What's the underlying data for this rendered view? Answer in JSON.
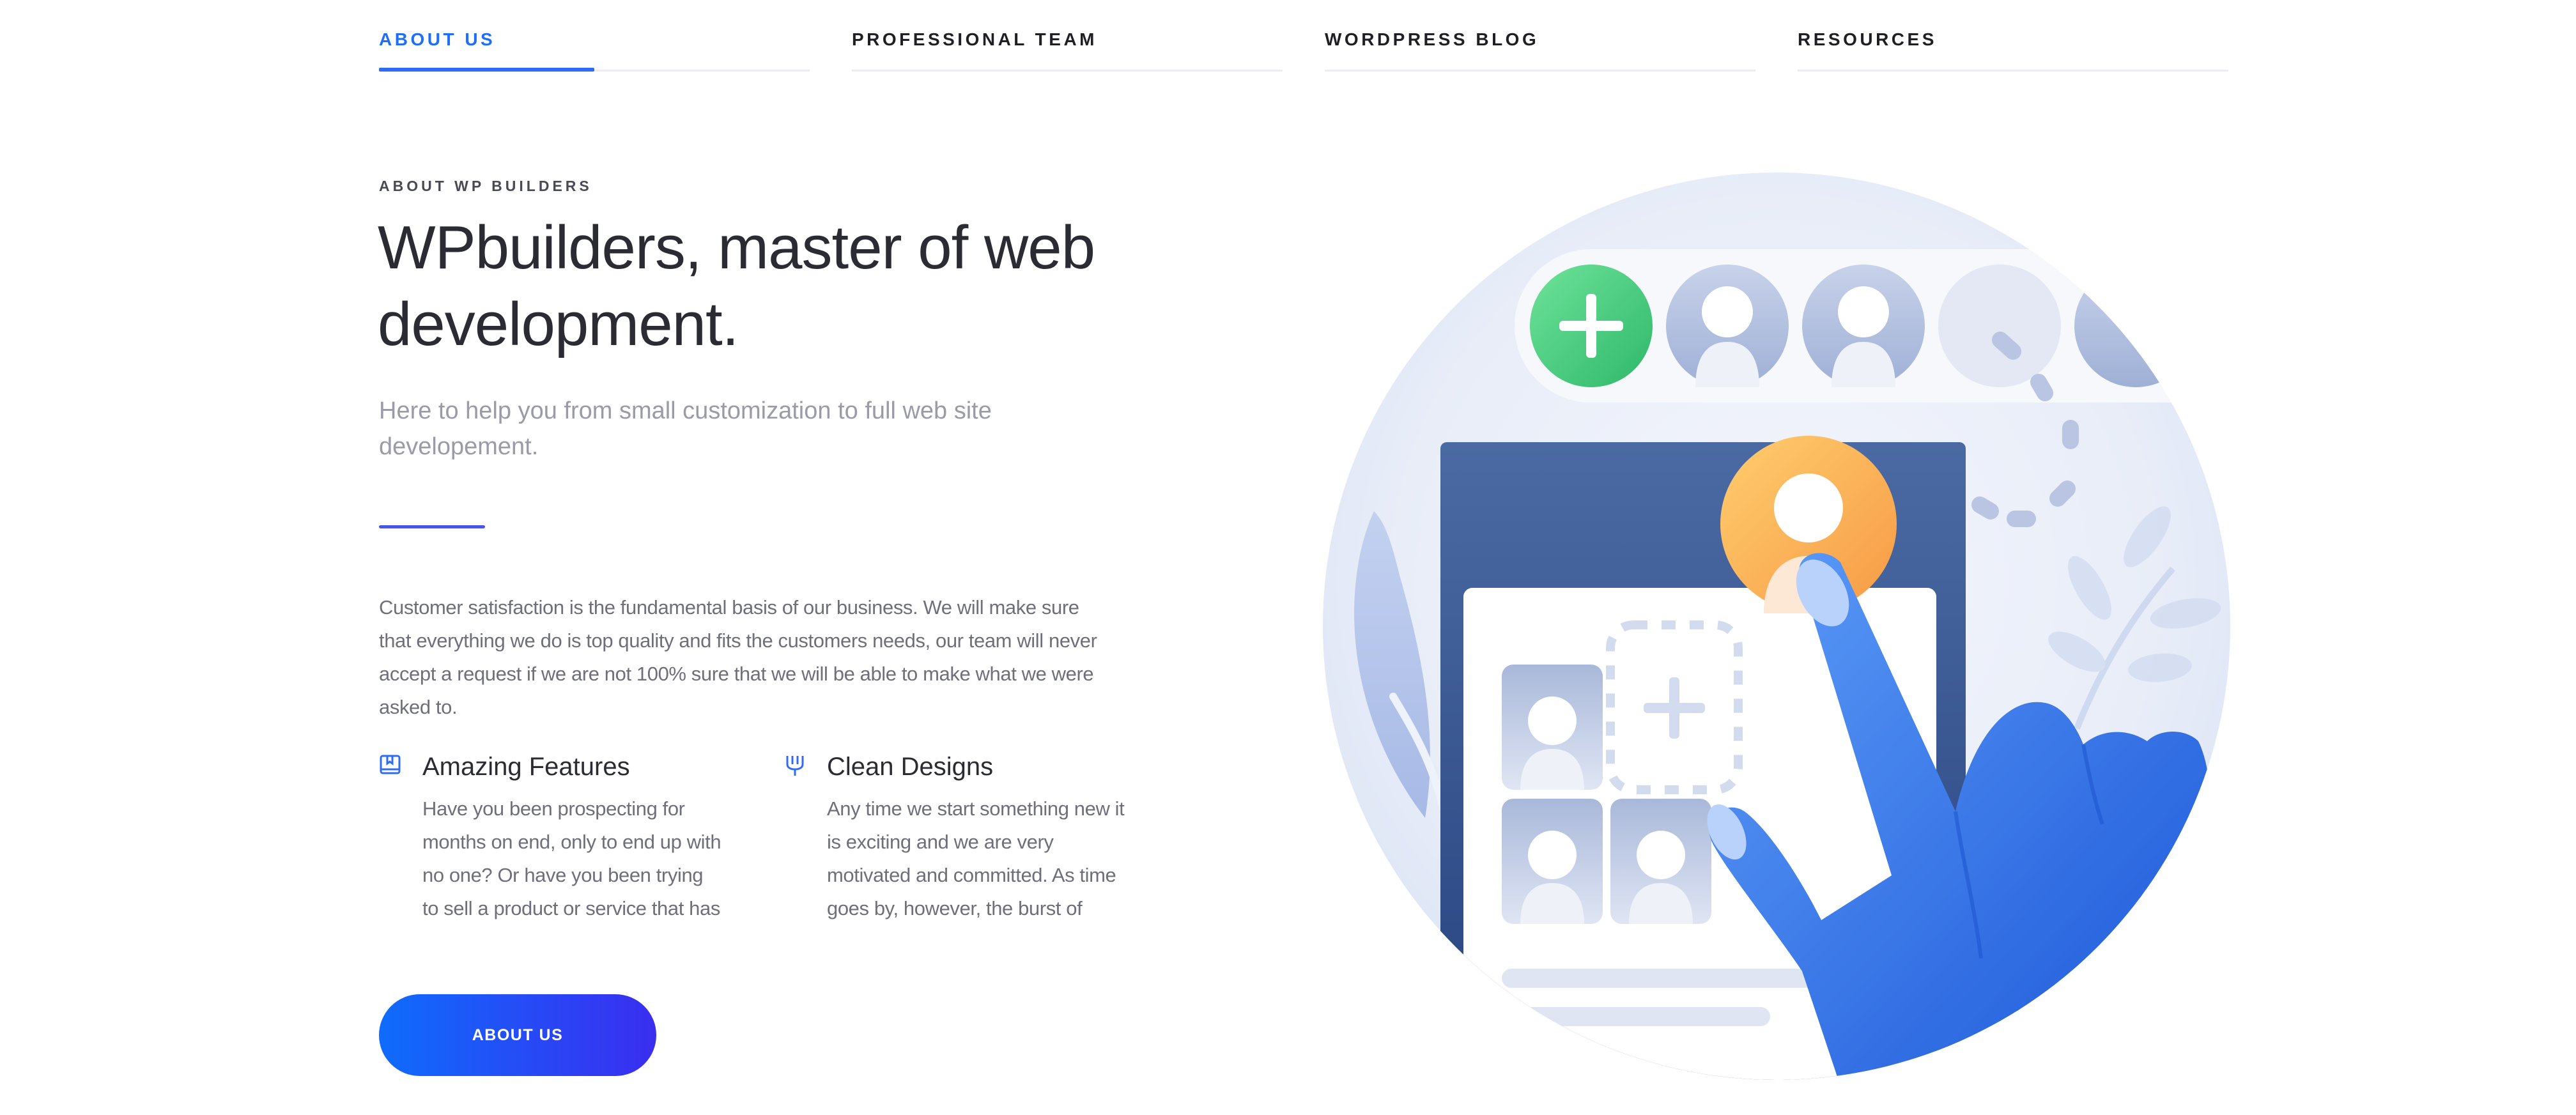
{
  "tabs": [
    {
      "label": "ABOUT US",
      "active": true
    },
    {
      "label": "PROFESSIONAL TEAM",
      "active": false
    },
    {
      "label": "WORDPRESS BLOG",
      "active": false
    },
    {
      "label": "RESOURCES",
      "active": false
    }
  ],
  "about": {
    "eyebrow": "ABOUT WP BUILDERS",
    "headline": "WPbuilders, master of web development.",
    "subtitle": "Here to help you from small customization to full web site developement.",
    "body": "Customer satisfaction is the fundamental basis of our business. We will make sure that everything we do is top quality and fits the customers needs, our team will never accept a request if we are not 100% sure that we will be able to make what we were asked to."
  },
  "features": [
    {
      "icon": "book-icon",
      "title": "Amazing Features",
      "description": "Have you been prospecting for months on end, only to end up with no one? Or have you been trying to sell a product or service that has not"
    },
    {
      "icon": "fork-icon",
      "title": "Clean Designs",
      "description": "Any time we start something new it is exciting and we are very motivated and committed. As time goes by, however, the burst of enthusiasm"
    }
  ],
  "cta": {
    "label": "ABOUT US"
  },
  "colors": {
    "accent": "#1e6dfb",
    "divider": "#4a55e8",
    "button_start": "#0f6cfc",
    "button_end": "#3a2ef0",
    "heading": "#2b2b33",
    "muted": "#9a9aa8"
  }
}
